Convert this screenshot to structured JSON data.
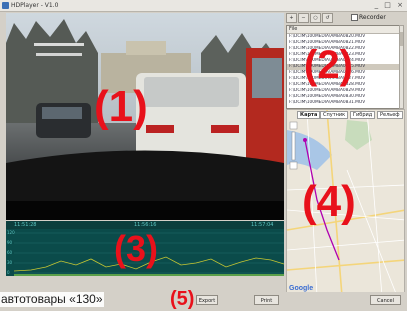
{
  "window": {
    "title": "HDPlayer - V1.0",
    "controls": "_ □ ×"
  },
  "toolbar": {
    "buttons": [
      "+",
      "−",
      "○",
      "↺"
    ],
    "record_label": "Recorder"
  },
  "file_list": {
    "header": "File",
    "rows": [
      "F:\\DCIM\\100MEDIA\\AMBA0820.MOV",
      "F:\\DCIM\\100MEDIA\\AMBA0821.MOV",
      "F:\\DCIM\\100MEDIA\\AMBA0822.MOV",
      "F:\\DCIM\\100MEDIA\\AMBA0823.MOV",
      "F:\\DCIM\\100MEDIA\\AMBA0824.MOV",
      "F:\\DCIM\\100MEDIA\\AMBA0825.MOV",
      "F:\\DCIM\\100MEDIA\\AMBA0826.MOV",
      "F:\\DCIM\\100MEDIA\\AMBA0827.MOV",
      "F:\\DCIM\\100MEDIA\\AMBA0828.MOV",
      "F:\\DCIM\\100MEDIA\\AMBA0829.MOV",
      "F:\\DCIM\\100MEDIA\\AMBA0830.MOV",
      "F:\\DCIM\\100MEDIA\\AMBA0831.MOV"
    ],
    "selected_index": 5
  },
  "map": {
    "tabs": [
      "Карта",
      "Спутник",
      "Гибрид",
      "Рельеф"
    ],
    "active_tab": 0,
    "logo": "Google"
  },
  "graph": {
    "time_left": "11:51:28",
    "time_mid": "11:56:16",
    "time_right": "11:57:04",
    "y_labels": [
      "120",
      "90",
      "60",
      "30",
      "0"
    ]
  },
  "overlay_labels": {
    "video": "(1)",
    "file_list": "(2)",
    "graph": "(3)",
    "map": "(4)",
    "buttons": "(5)"
  },
  "status_buttons": {
    "export": "Export",
    "print": "Print",
    "cancel": "Cancel"
  },
  "caption": "автотовары «130»",
  "colors": {
    "accent_red": "#e8111b",
    "graph_bg": "#0b4b4a",
    "graph_line": "#c8c832",
    "map_route": "#b000b0"
  }
}
